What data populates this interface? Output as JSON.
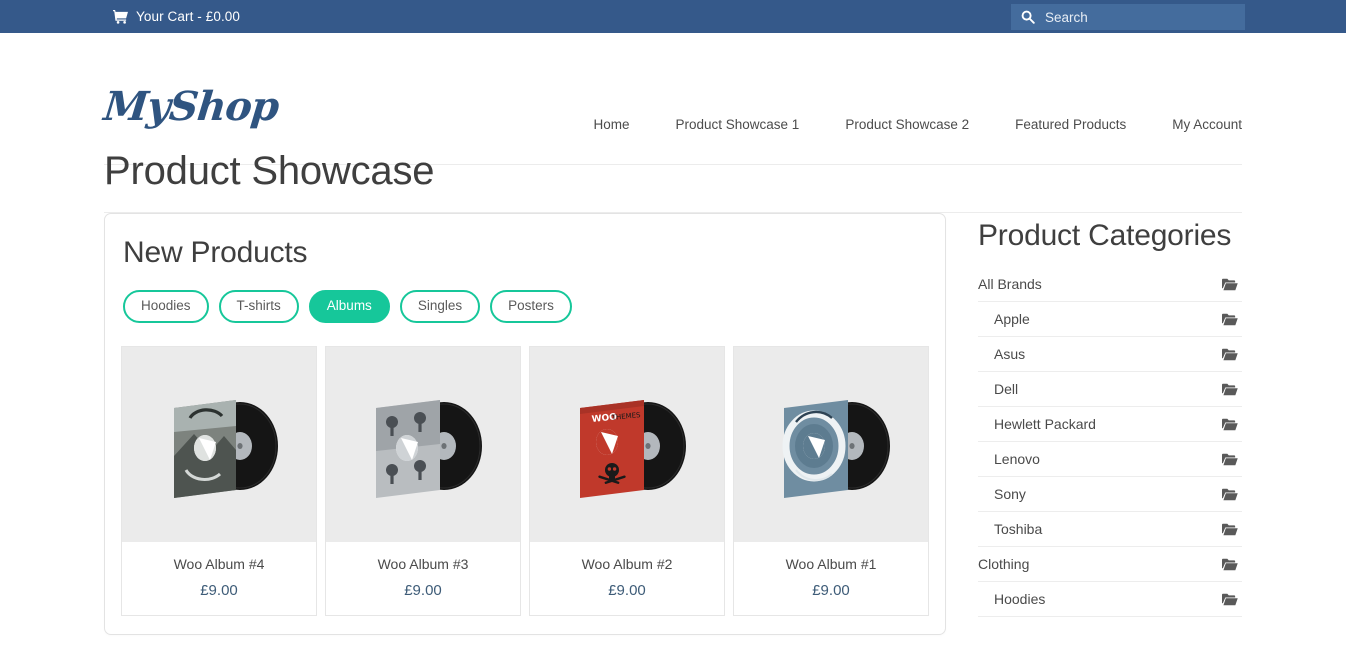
{
  "topbar": {
    "cart_label": "Your Cart - £0.00",
    "cart_icon": "shopping-cart-icon",
    "search_icon": "search-icon",
    "search_placeholder": "Search",
    "search_value": "",
    "bg_color": "#35598a",
    "search_bg_color": "#446c9d"
  },
  "header": {
    "logo": "MyShop",
    "logo_color": "#2f5480",
    "nav": [
      {
        "label": "Home"
      },
      {
        "label": "Product Showcase 1"
      },
      {
        "label": "Product Showcase 2"
      },
      {
        "label": "Featured Products"
      },
      {
        "label": "My Account"
      }
    ]
  },
  "page": {
    "title": "Product Showcase"
  },
  "showcase": {
    "title": "New Products",
    "accent_color": "#16c79a",
    "filters": [
      {
        "label": "Hoodies",
        "active": false
      },
      {
        "label": "T-shirts",
        "active": false
      },
      {
        "label": "Albums",
        "active": true
      },
      {
        "label": "Singles",
        "active": false
      },
      {
        "label": "Posters",
        "active": false
      }
    ],
    "products": [
      {
        "name": "Woo Album #4",
        "price": "£9.00",
        "sleeve_color": "#8d9390",
        "art": "landscape-photo-sleeve"
      },
      {
        "name": "Woo Album #3",
        "price": "£9.00",
        "sleeve_color": "#b9bdc0",
        "art": "grey-keyhole-sleeve"
      },
      {
        "name": "Woo Album #2",
        "price": "£9.00",
        "sleeve_color": "#c0392b",
        "art": "red-skull-sleeve"
      },
      {
        "name": "Woo Album #1",
        "price": "£9.00",
        "sleeve_color": "#6f8da1",
        "art": "blue-ring-sleeve"
      }
    ]
  },
  "sidebar": {
    "title": "Product Categories",
    "categories": [
      {
        "label": "All Brands",
        "indent": false,
        "icon": "folder-open-icon"
      },
      {
        "label": "Apple",
        "indent": true,
        "icon": "folder-open-icon"
      },
      {
        "label": "Asus",
        "indent": true,
        "icon": "folder-open-icon"
      },
      {
        "label": "Dell",
        "indent": true,
        "icon": "folder-open-icon"
      },
      {
        "label": "Hewlett Packard",
        "indent": true,
        "icon": "folder-open-icon"
      },
      {
        "label": "Lenovo",
        "indent": true,
        "icon": "folder-open-icon"
      },
      {
        "label": "Sony",
        "indent": true,
        "icon": "folder-open-icon"
      },
      {
        "label": "Toshiba",
        "indent": true,
        "icon": "folder-open-icon"
      },
      {
        "label": "Clothing",
        "indent": false,
        "icon": "folder-open-icon"
      },
      {
        "label": "Hoodies",
        "indent": true,
        "icon": "folder-open-icon"
      }
    ]
  }
}
